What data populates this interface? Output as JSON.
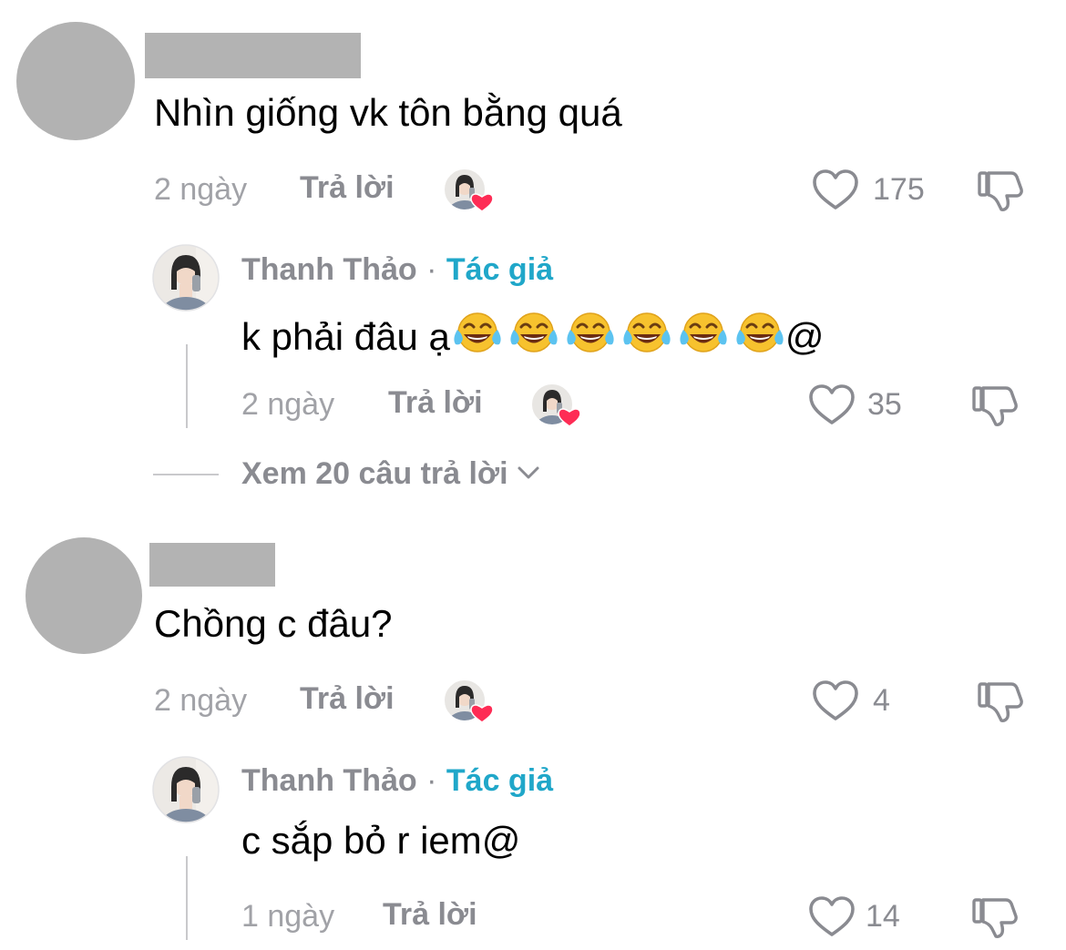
{
  "comments": [
    {
      "text": "Nhìn giống vk tôn bằng quá",
      "date": "2 ngày",
      "reply_label": "Trả lời",
      "likes": "175",
      "reply": {
        "author": "Thanh Thảo",
        "separator": "·",
        "author_tag": "Tác giả",
        "text": "k phải đâu ạ",
        "text_suffix": "@",
        "emoji_count": 6,
        "date": "2 ngày",
        "reply_label": "Trả lời",
        "likes": "35"
      },
      "view_replies": "Xem 20 câu trả lời"
    },
    {
      "text": "Chồng c đâu?",
      "date": "2 ngày",
      "reply_label": "Trả lời",
      "likes": "4",
      "reply": {
        "author": "Thanh Thảo",
        "separator": "·",
        "author_tag": "Tác giả",
        "text": "c sắp bỏ r iem@",
        "date": "1 ngày",
        "reply_label": "Trả lời",
        "likes": "14"
      }
    }
  ],
  "icons": {
    "like": "heart-outline-icon",
    "dislike": "thumbs-down-icon",
    "creator_liked": "creator-liked-heart-icon",
    "emoji": "face-with-tears-of-joy-emoji",
    "expand": "chevron-down-icon"
  },
  "colors": {
    "author_tag": "#20a7c9",
    "creator_heart": "#fe2c55",
    "secondary_text": "#8a8b91"
  }
}
